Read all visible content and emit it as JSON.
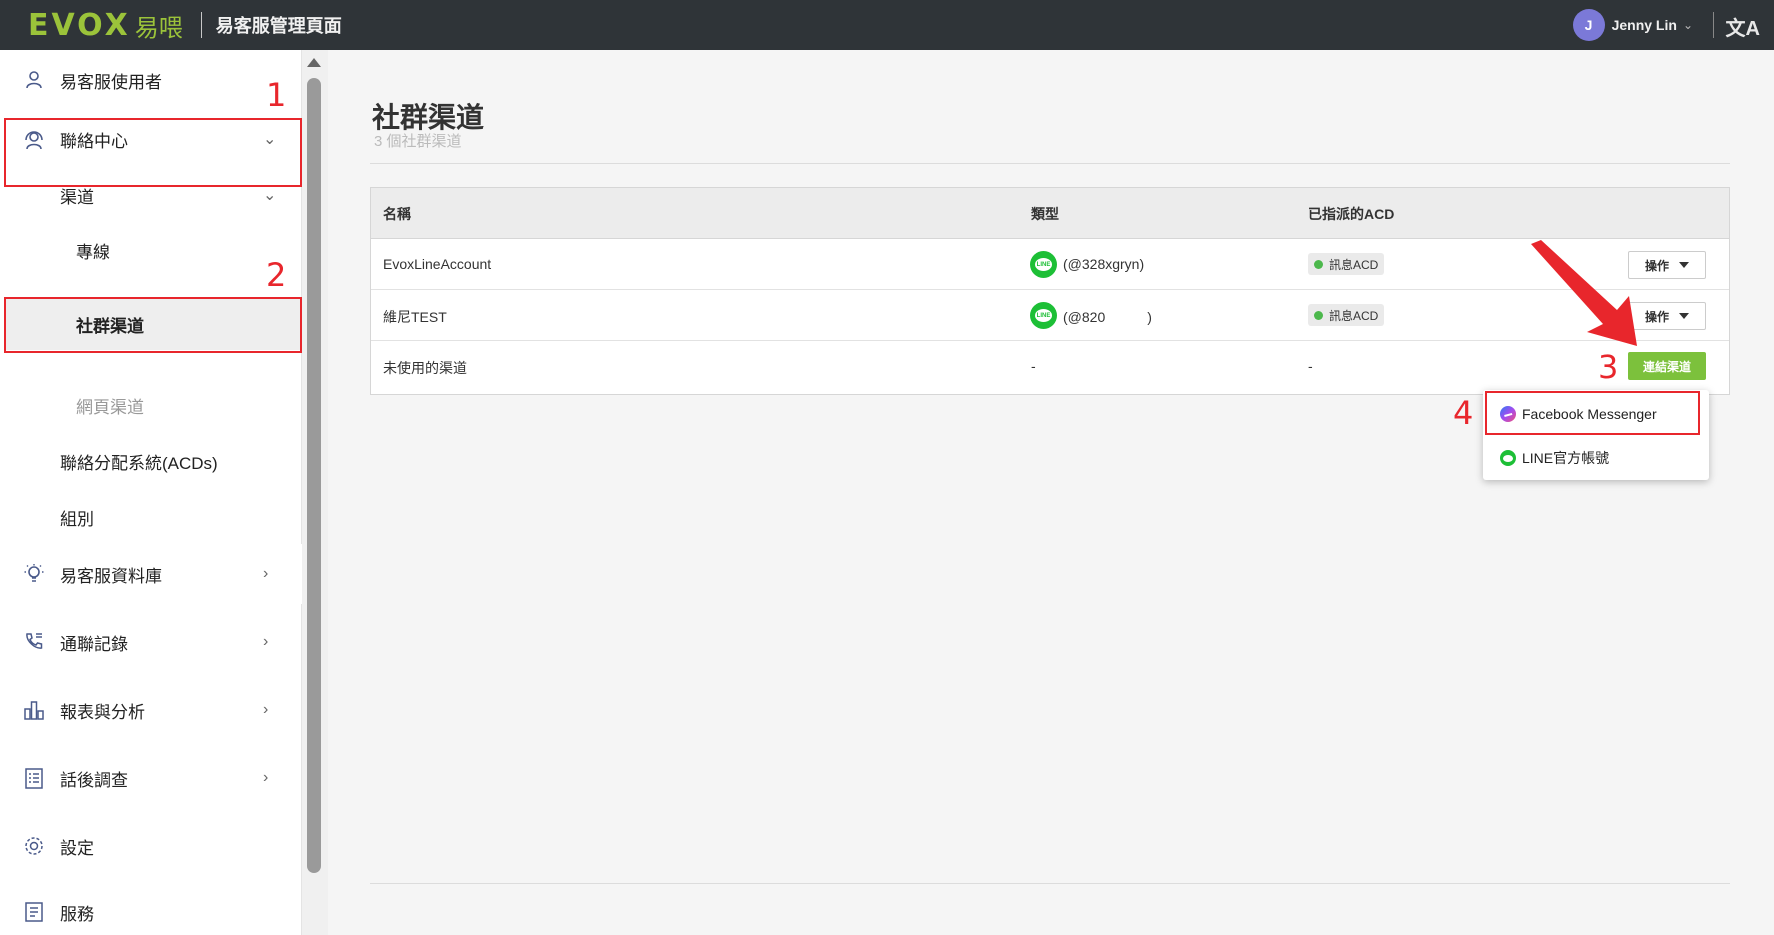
{
  "header": {
    "logo_text": "EVOX",
    "logo_cn": "易喂",
    "app_title": "易客服管理頁面",
    "user_initial": "J",
    "user_name": "Jenny Lin",
    "translate_icon": "translate-icon"
  },
  "sidebar": {
    "items": [
      {
        "label": "易客服使用者",
        "icon": "user-icon"
      },
      {
        "label": "聯絡中心",
        "icon": "headset-icon"
      },
      {
        "label": "渠道"
      },
      {
        "label": "專線"
      },
      {
        "label": "社群渠道"
      },
      {
        "label": "網頁渠道"
      },
      {
        "label": "聯絡分配系統(ACDs)"
      },
      {
        "label": "組別"
      },
      {
        "label": "易客服資料庫",
        "icon": "lightbulb-icon"
      },
      {
        "label": "通聯記錄",
        "icon": "phone-log-icon"
      },
      {
        "label": "報表與分析",
        "icon": "bar-chart-icon"
      },
      {
        "label": "話後調查",
        "icon": "survey-icon"
      },
      {
        "label": "設定",
        "icon": "gear-icon"
      },
      {
        "label": "服務",
        "icon": "service-icon"
      }
    ]
  },
  "main": {
    "title": "社群渠道",
    "subtitle": "3 個社群渠道",
    "table": {
      "headers": [
        "名稱",
        "類型",
        "已指派的ACD"
      ],
      "rows": [
        {
          "name": "EvoxLineAccount",
          "type": "(@328xgryn)",
          "acd": "訊息ACD",
          "action": "操作"
        },
        {
          "name": "維尼TEST",
          "type": "(@820　　　)",
          "acd": "訊息ACD",
          "action": "操作"
        },
        {
          "name": "未使用的渠道",
          "type": "-",
          "acd": "-",
          "action": "連結渠道"
        }
      ]
    },
    "dropdown": {
      "items": [
        "Facebook Messenger",
        "LINE官方帳號"
      ]
    }
  },
  "annotations": [
    "1",
    "2",
    "3",
    "4"
  ],
  "colors": {
    "accent_green": "#7cc13c",
    "line_green": "#1dbf36",
    "annotation_red": "#e8262c",
    "topbar": "#2f3438"
  }
}
